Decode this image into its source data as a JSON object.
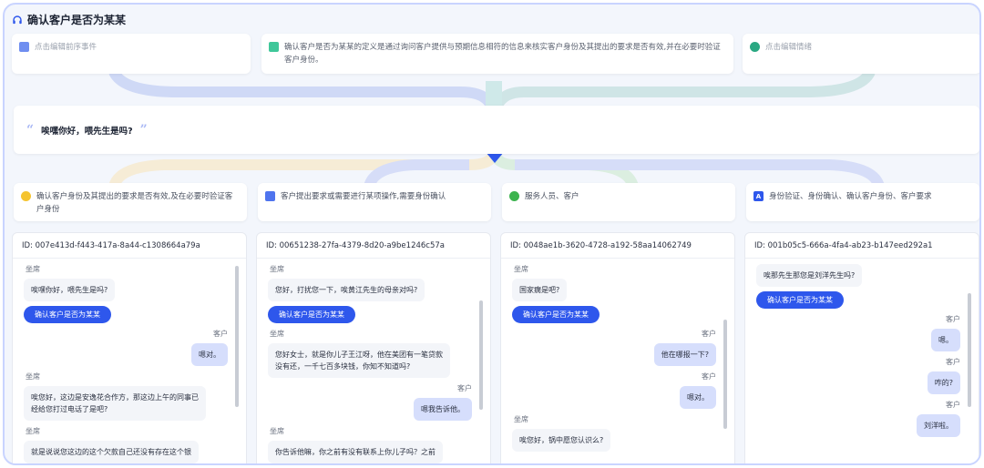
{
  "title": "确认客户是否为某某",
  "top": {
    "left": "点击编辑前序事件",
    "center": "确认客户是否为某某的定义是通过询问客户提供与预期信息相符的信息来核实客户身份及其提出的要求是否有效,并在必要时验证客户身份。",
    "right": "点击编辑情绪"
  },
  "utterance": "唉嘿你好，喂先生是吗?",
  "attributes": [
    "确认客户身份及其提出的要求是否有效,及在必要时验证客户身份",
    "客户提出要求或需要进行某项操作,需要身份确认",
    "服务人员、客户",
    "身份验证、身份确认、确认客户身份、客户要求"
  ],
  "labels": {
    "agent": "坐席",
    "customer": "客户",
    "button": "确认客户是否为某某"
  },
  "columns": [
    {
      "id": "ID: 007e413d-f443-417a-8a44-c1308664a79a",
      "m1": "唉嘿你好，喂先生是吗?",
      "m2": "嗯对。",
      "m3": "唉您好，这边是安逸花合作方，那这边上午的同事已经给您打过电话了是吧?",
      "m4": "就是说说您这边的这个欠款自己还没有存在这个银"
    },
    {
      "id": "ID: 00651238-27fa-4379-8d20-a9be1246c57a",
      "m1": "您好，打扰您一下，唉黄江先生的母亲对吗?",
      "m2": "您好女士，就是你儿子王江呀，他在美团有一笔贷款没有还，一千七百多块钱，你知不知道吗?",
      "m3": "嗯我告诉他。",
      "m4": "你告诉他嘛，你之前有没有联系上你儿子吗？之前"
    },
    {
      "id": "ID: 0048ae1b-3620-4728-a192-58aa14062749",
      "m1": "国家瘸是吧?",
      "m2": "他在哪报一下?",
      "m3": "嗯对。",
      "m4": "唉您好，锅中愿您认识么?"
    },
    {
      "id": "ID: 001b05c5-666a-4fa4-ab23-b147eed292a1",
      "m1": "唉那先生那您是刘洋先生吗?",
      "m2": "嗯。",
      "m3": "咋的?",
      "m4": "刘洋啦。"
    }
  ]
}
